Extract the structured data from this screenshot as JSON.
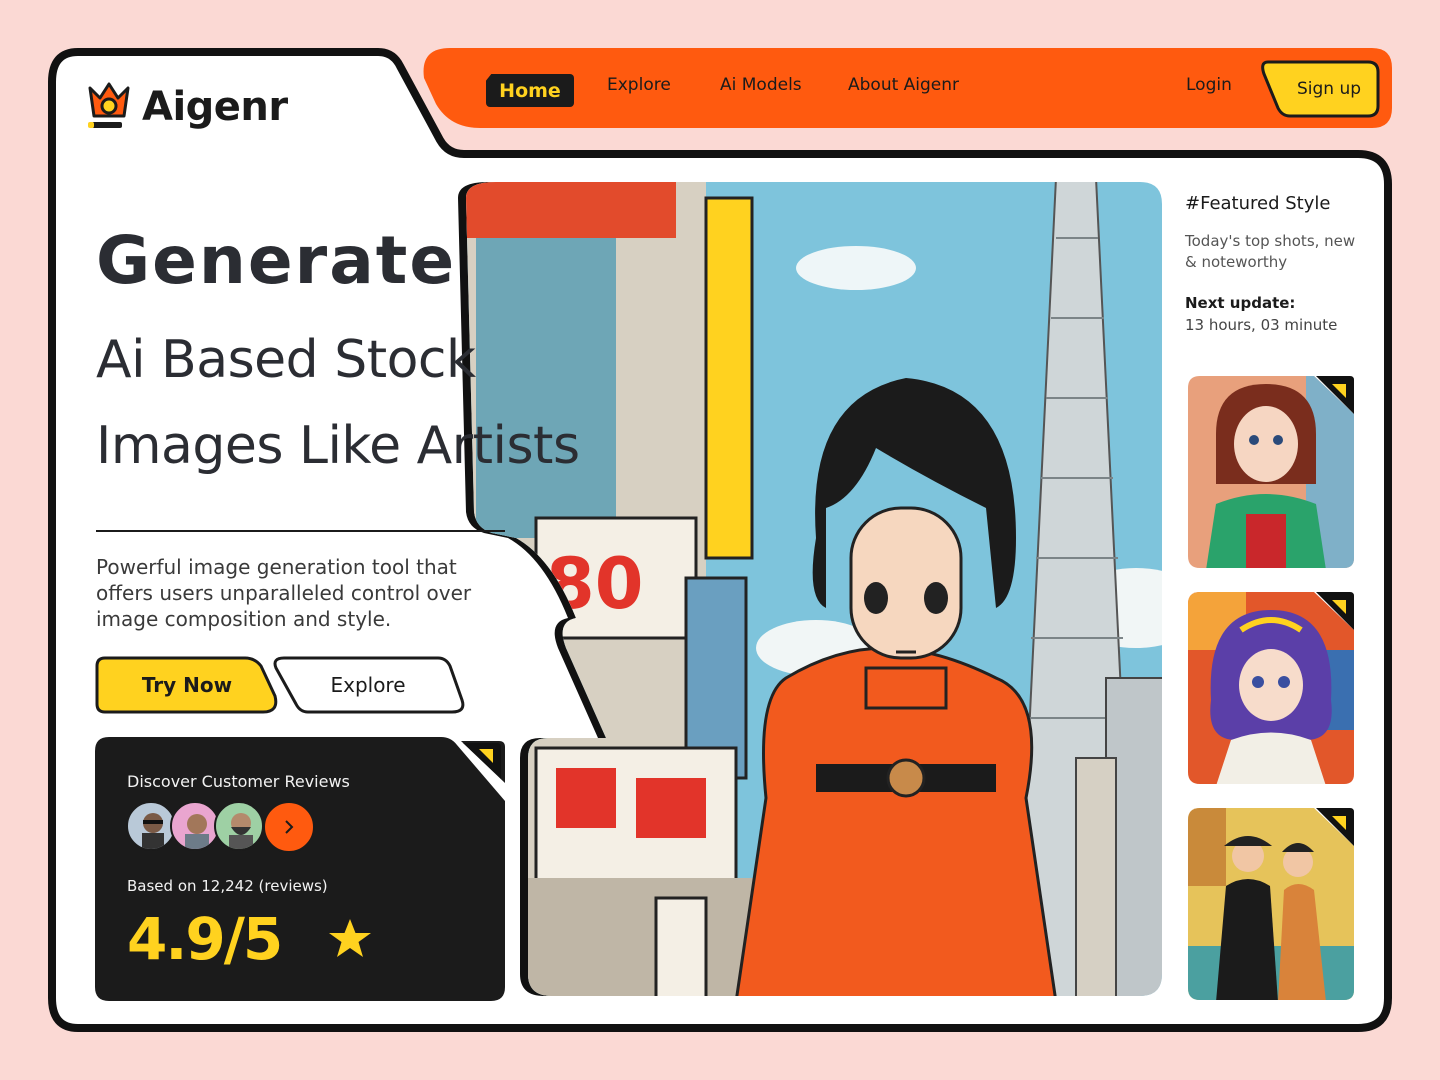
{
  "brand": {
    "name": "Aigenr"
  },
  "nav": {
    "items": [
      "Home",
      "Explore",
      "Ai Models",
      "About Aigenr"
    ],
    "active": "Home",
    "login": "Login",
    "signup": "Sign up"
  },
  "hero": {
    "headline": "Generate",
    "line1": "Ai Based Stock",
    "line2": "Images Like Artists",
    "description": "Powerful image generation tool that offers users unparalleled control over image composition and style.",
    "cta_primary": "Try Now",
    "cta_secondary": "Explore"
  },
  "reviews": {
    "title": "Discover Customer Reviews",
    "based_on": "Based on 12,242 (reviews)",
    "score": "4.9/5",
    "rating": 4.9,
    "rating_max": 5
  },
  "featured": {
    "title": "#Featured Style",
    "subtitle": "Today's top shots, new & noteworthy",
    "next_update_label": "Next update:",
    "next_update_value": "13 hours, 03 minute"
  },
  "colors": {
    "background": "#fbd9d4",
    "accent_orange": "#ff5a0f",
    "accent_yellow": "#ffd21f",
    "ink": "#1b1b1b"
  },
  "icons": [
    "crown-logo-icon",
    "chevron-right-icon",
    "star-icon",
    "corner-tag-icon"
  ]
}
